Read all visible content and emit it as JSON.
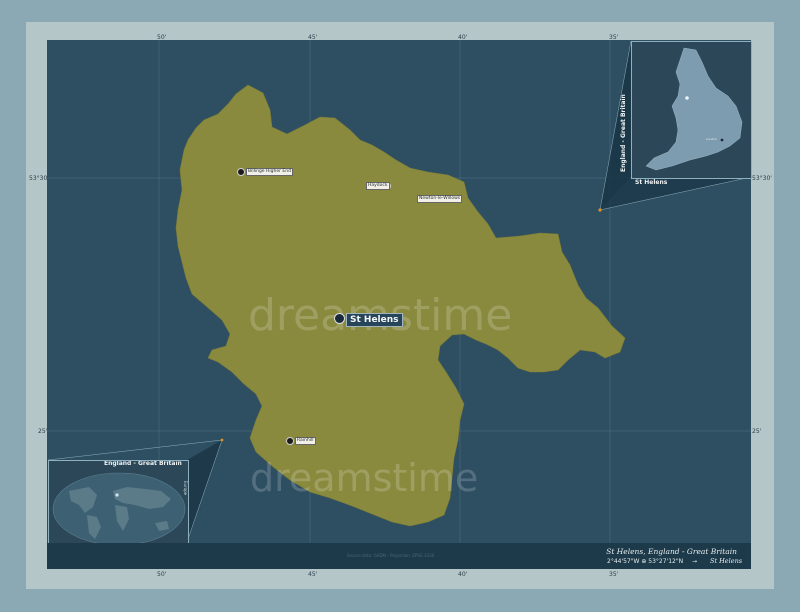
{
  "map": {
    "region_name": "St Helens",
    "region_color": "#8a8a3f",
    "background_color": "#2e4f62",
    "frame_color": "#b5c6c9"
  },
  "ticks": {
    "top": [
      "50'",
      "45'",
      "40'",
      "35'"
    ],
    "bottom": [
      "50'",
      "45'",
      "40'",
      "35'"
    ],
    "left": [
      "53°30'",
      "25'"
    ],
    "right": [
      "53°30'",
      "25'"
    ]
  },
  "towns": [
    {
      "name": "Billinge Higher End"
    },
    {
      "name": "Haydock"
    },
    {
      "name": "Newton-le-Willows"
    },
    {
      "name": "Rainhill"
    }
  ],
  "main_town": {
    "name": "St Helens"
  },
  "insets": {
    "globe_title": "England - Great Britain",
    "globe_side_label": "Europe",
    "england_title": "England - Great Britain",
    "england_region_label": "St Helens",
    "england_small_city": "London"
  },
  "bottom_bar": {
    "title": "St Helens, England - Great Britain",
    "coords": "2°44'57\"W ⊕ 53°27'12\"N",
    "arrow": "→",
    "region": "St Helens",
    "source": "Source data: GADM - Projection: EPSG 4326"
  },
  "watermark": "dreamstime"
}
